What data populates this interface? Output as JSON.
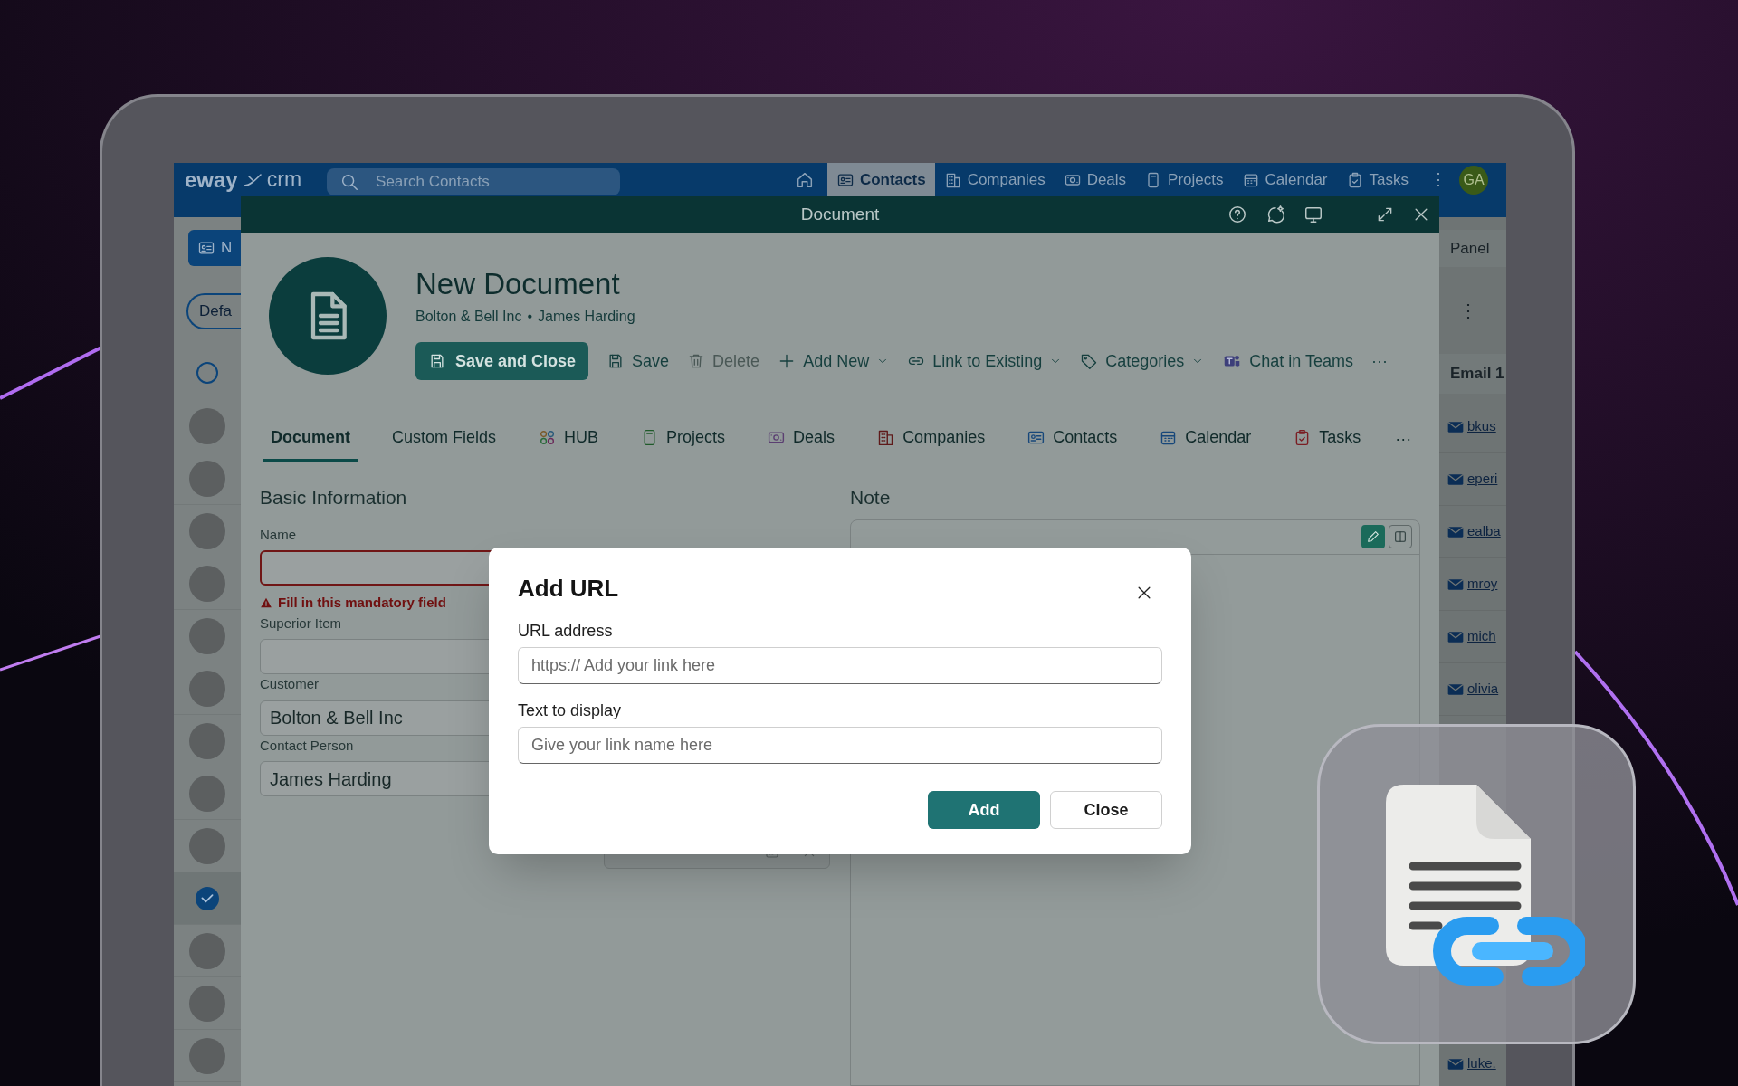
{
  "app": {
    "logo": {
      "word": "eway",
      "suffix": "crm"
    },
    "search": {
      "placeholder": "Search Contacts"
    },
    "nav": [
      {
        "label": "Contacts",
        "selected": true
      },
      {
        "label": "Companies",
        "selected": false
      },
      {
        "label": "Deals",
        "selected": false
      },
      {
        "label": "Projects",
        "selected": false
      },
      {
        "label": "Calendar",
        "selected": false
      },
      {
        "label": "Tasks",
        "selected": false
      }
    ],
    "nav_more": "⋮",
    "user_initials": "GA",
    "sidebar": {
      "new_button": "N",
      "view_filter": "Defa",
      "select_all": {
        "checked": false
      },
      "rows": [
        {
          "checked": false
        },
        {
          "checked": false
        },
        {
          "checked": false
        },
        {
          "checked": false
        },
        {
          "checked": false
        },
        {
          "checked": false
        },
        {
          "checked": false
        },
        {
          "checked": false
        },
        {
          "checked": false
        },
        {
          "checked": true
        },
        {
          "checked": false
        },
        {
          "checked": false
        },
        {
          "checked": false
        }
      ]
    },
    "right_panel": {
      "title": "Panel",
      "more": "⋮",
      "column": "Email 1",
      "emails": [
        "bkus",
        "eperi",
        "ealba",
        "mroy",
        "mich",
        "olivia"
      ],
      "last_email": "luke."
    }
  },
  "document_window": {
    "title": "Document",
    "header": {
      "title": "New Document",
      "customer": "Bolton & Bell Inc",
      "separator": "•",
      "contact": "James Harding"
    },
    "toolbar": [
      {
        "label": "Save and Close",
        "kind": "primary",
        "disabled": false
      },
      {
        "label": "Save",
        "kind": "action",
        "disabled": false
      },
      {
        "label": "Delete",
        "kind": "action",
        "disabled": true
      },
      {
        "label": "Add New",
        "kind": "menu",
        "disabled": false
      },
      {
        "label": "Link to Existing",
        "kind": "menu",
        "disabled": false
      },
      {
        "label": "Categories",
        "kind": "menu",
        "disabled": false
      },
      {
        "label": "Chat in Teams",
        "kind": "action",
        "disabled": false
      },
      {
        "label": "···",
        "kind": "more",
        "disabled": false
      }
    ],
    "tabs": [
      {
        "label": "Document",
        "selected": true
      },
      {
        "label": "Custom Fields",
        "selected": false
      },
      {
        "label": "HUB",
        "selected": false
      },
      {
        "label": "Projects",
        "selected": false
      },
      {
        "label": "Deals",
        "selected": false
      },
      {
        "label": "Companies",
        "selected": false
      },
      {
        "label": "Contacts",
        "selected": false
      },
      {
        "label": "Calendar",
        "selected": false
      },
      {
        "label": "Tasks",
        "selected": false
      }
    ],
    "tabs_more": "···",
    "basic_information": {
      "heading": "Basic Information",
      "fields": [
        {
          "kind": "text",
          "label": "Name",
          "error": "Fill in this mandatory field"
        },
        {
          "kind": "text",
          "label": "Superior Item"
        },
        {
          "kind": "text",
          "label": "Customer",
          "value": "Bolton & Bell Inc"
        },
        {
          "kind": "text",
          "label": "Contact Person",
          "value": "James Harding"
        },
        {
          "kind": "date"
        }
      ]
    },
    "note": {
      "heading": "Note",
      "modes": [
        {
          "selected": true
        },
        {
          "selected": false
        }
      ]
    }
  },
  "dialog": {
    "title": "Add URL",
    "fields": [
      {
        "label": "URL address",
        "placeholder": "https:// Add your link here"
      },
      {
        "label": "Text to display",
        "placeholder": "Give your link name here"
      }
    ],
    "buttons": [
      {
        "label": "Add",
        "kind": "primary"
      },
      {
        "label": "Close",
        "kind": "secondary"
      }
    ]
  }
}
